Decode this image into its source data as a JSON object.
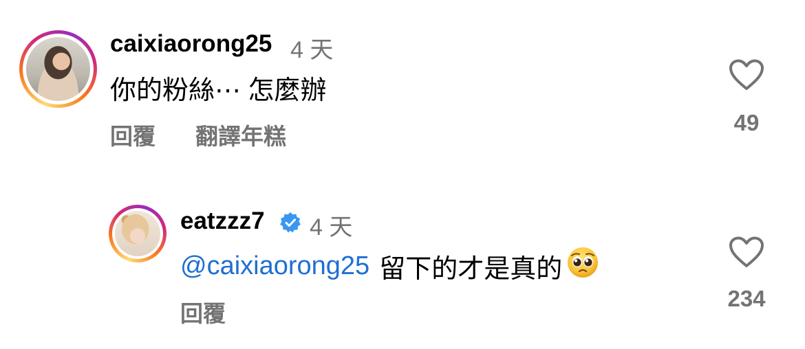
{
  "comments": [
    {
      "username": "caixiaorong25",
      "time": "4 天",
      "text": "你的粉絲⋯ 怎麼辦",
      "actions": {
        "reply": "回覆",
        "translate": "翻譯年糕"
      },
      "likes": "49",
      "verified": false,
      "avatar_icon": "avatar-photo"
    }
  ],
  "replies": [
    {
      "username": "eatzzz7",
      "time": "4 天",
      "mention": "@caixiaorong25",
      "text": "留下的才是真的",
      "emoji": "pleading-face",
      "actions": {
        "reply": "回覆"
      },
      "likes": "234",
      "verified": true,
      "avatar_icon": "avatar-photo"
    }
  ],
  "colors": {
    "mention": "#1f6fd1",
    "secondary_text": "#737373",
    "verified": "#3897f0"
  }
}
